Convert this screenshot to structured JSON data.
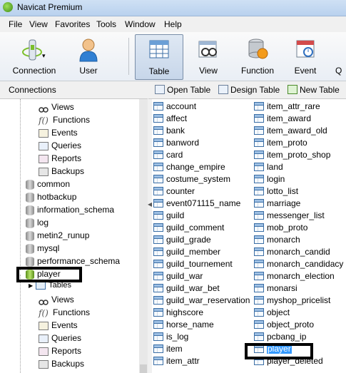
{
  "window": {
    "title": "Navicat Premium"
  },
  "menu": [
    "File",
    "View",
    "Favorites",
    "Tools",
    "Window",
    "Help"
  ],
  "toolbar": {
    "connection": "Connection",
    "user": "User",
    "table": "Table",
    "view": "View",
    "function": "Function",
    "event": "Event",
    "partial": "Q"
  },
  "connections_header": "Connections",
  "object_toolbar": {
    "open": "Open Table",
    "design": "Design Table",
    "new": "New Table"
  },
  "tree": {
    "top_children": [
      "Views",
      "Functions",
      "Events",
      "Queries",
      "Reports",
      "Backups"
    ],
    "databases": [
      "common",
      "hotbackup",
      "information_schema",
      "log",
      "metin2_runup",
      "mysql",
      "performance_schema",
      "player"
    ],
    "player_children": [
      "Tables",
      "Views",
      "Functions",
      "Events",
      "Queries",
      "Reports",
      "Backups"
    ]
  },
  "tables_col1": [
    "account",
    "affect",
    "bank",
    "banword",
    "card",
    "change_empire",
    "costume_system",
    "counter",
    "event071115_name",
    "guild",
    "guild_comment",
    "guild_grade",
    "guild_member",
    "guild_tournement",
    "guild_war",
    "guild_war_bet",
    "guild_war_reservation",
    "highscore",
    "horse_name",
    "is_log",
    "item",
    "item_attr"
  ],
  "tables_col2": [
    "item_attr_rare",
    "item_award",
    "item_award_old",
    "item_proto",
    "item_proto_shop",
    "land",
    "login",
    "lotto_list",
    "marriage",
    "messenger_list",
    "mob_proto",
    "monarch",
    "monarch_candid",
    "monarch_candidacy",
    "monarch_election",
    "monarsi",
    "myshop_pricelist",
    "object",
    "object_proto",
    "pcbang_ip",
    "player",
    "player_deleted"
  ],
  "selected_table": "player",
  "colors": {
    "selection": "#3399ff",
    "highlight_box": "#000000"
  }
}
